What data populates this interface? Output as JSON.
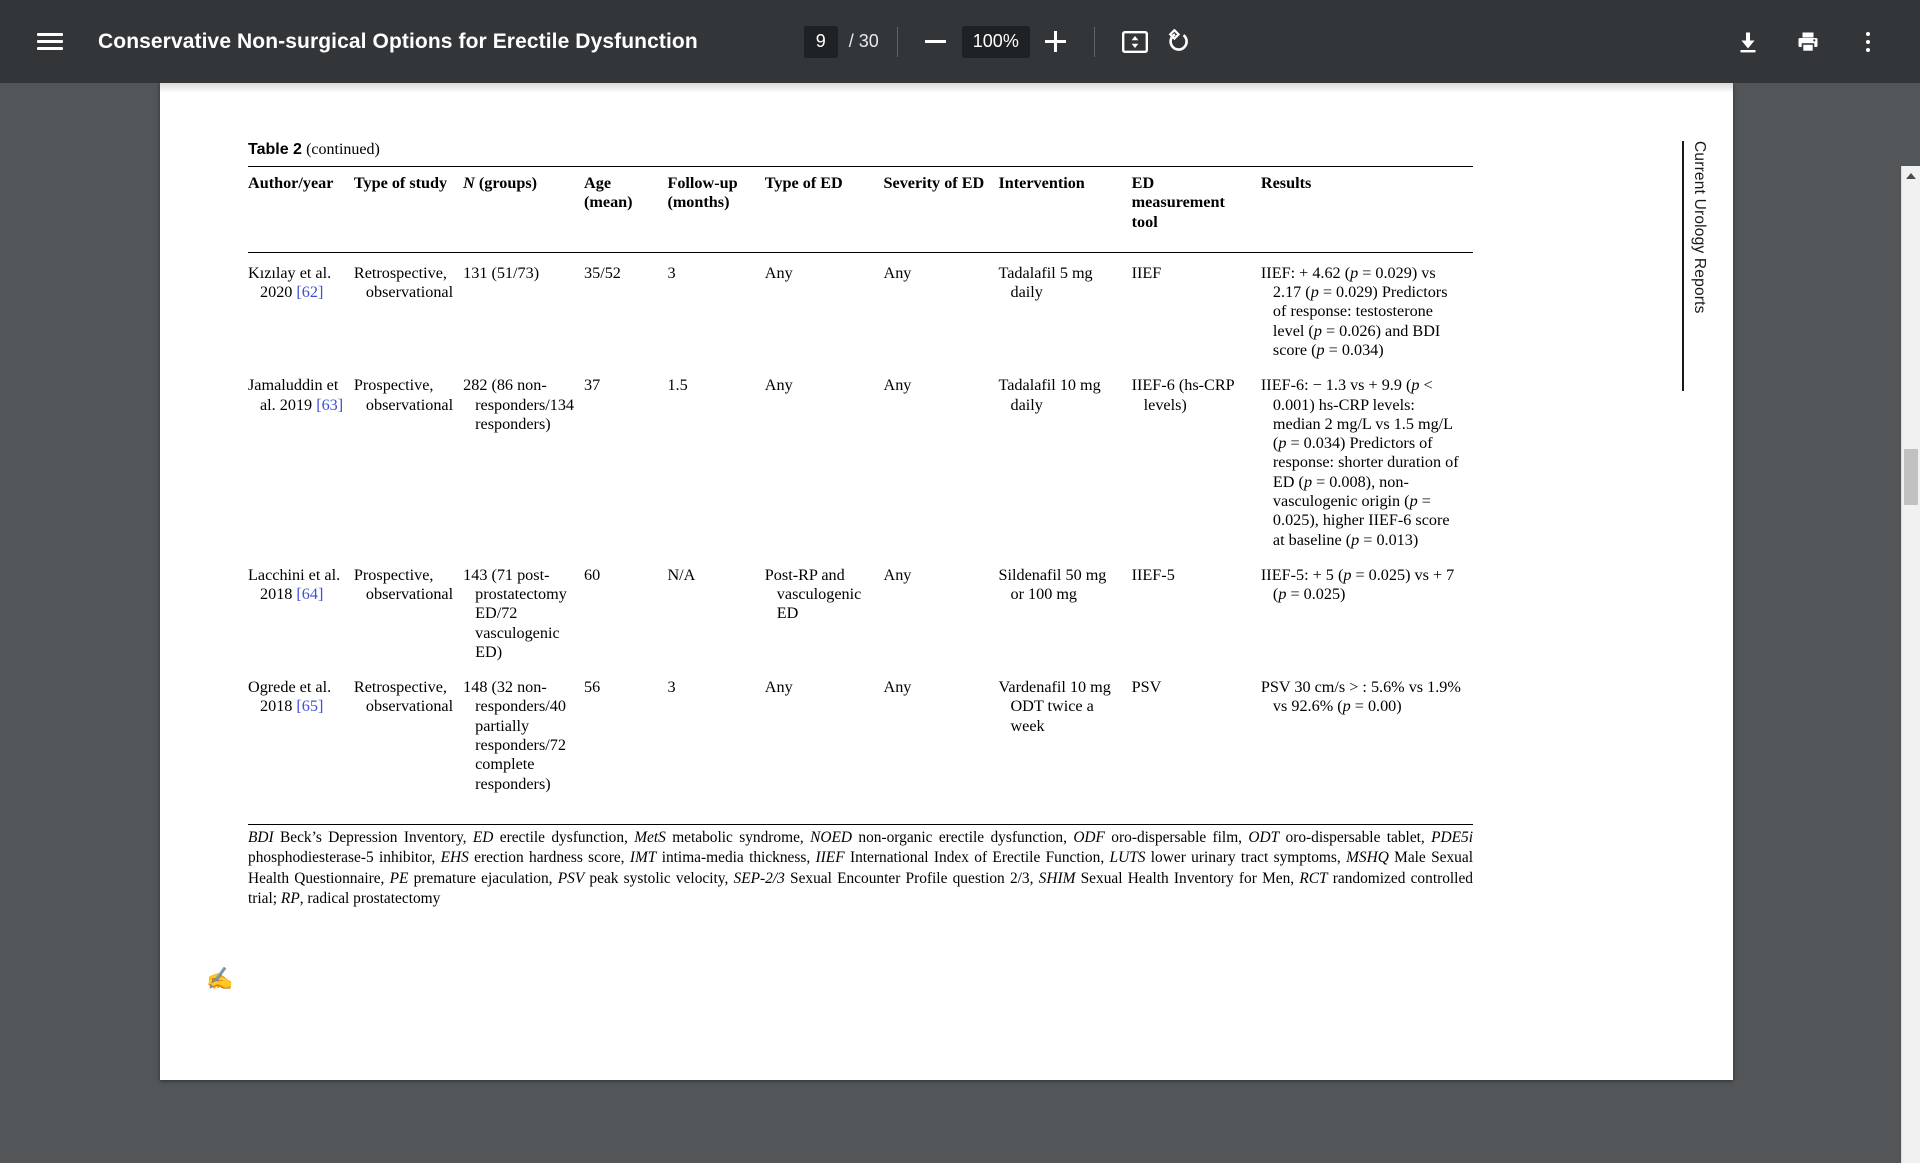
{
  "toolbar": {
    "menu_icon": "hamburger-menu-icon",
    "title": "Conservative Non-surgical Options for Erectile Dysfunction",
    "page_current": "9",
    "page_total": "/ 30",
    "zoom_out_icon": "minus-icon",
    "zoom_level": "100%",
    "zoom_in_icon": "plus-icon",
    "fit_icon": "fit-to-page-icon",
    "rotate_icon": "rotate-counterclockwise-icon",
    "download_icon": "download-icon",
    "print_icon": "print-icon",
    "more_icon": "more-vertical-icon"
  },
  "scrollbar": {
    "up_arrow_icon": "scroll-up-arrow-icon",
    "thumb": "scroll-thumb"
  },
  "page": {
    "journal_label": "Current Urology Reports",
    "hand_glyph": "✍",
    "table": {
      "caption_label": "Table 2",
      "caption_continued": "(continued)",
      "headers": [
        "Author/year",
        "Type of study",
        "N (groups)",
        "Age (mean)",
        "Follow-up (months)",
        "Type of ED",
        "Severity of ED",
        "Intervention",
        "ED measurement tool",
        "Results"
      ],
      "rows": [
        {
          "author": "Kızılay et al. 2020",
          "ref": "[62]",
          "type_of_study": "Retrospective, observational",
          "n_groups": "131 (51/73)",
          "age_mean": "35/52",
          "follow_up": "3",
          "type_of_ed": "Any",
          "severity_of_ed": "Any",
          "intervention": "Tadalafil 5 mg daily",
          "measurement_tool": "IIEF",
          "results": "IIEF: + 4.62 (p = 0.029) vs 2.17 (p = 0.029) Predictors of response: testosterone level (p = 0.026) and BDI score (p = 0.034)"
        },
        {
          "author": "Jamaluddin et al. 2019",
          "ref": "[63]",
          "type_of_study": "Prospective, observational",
          "n_groups": "282 (86 non-responders/134 responders)",
          "age_mean": "37",
          "follow_up": "1.5",
          "type_of_ed": "Any",
          "severity_of_ed": "Any",
          "intervention": "Tadalafil 10 mg daily",
          "measurement_tool": "IIEF-6 (hs-CRP levels)",
          "results": "IIEF-6: − 1.3 vs + 9.9 (p < 0.001) hs-CRP levels: median 2 mg/L vs 1.5 mg/L (p = 0.034) Predictors of response: shorter duration of ED (p = 0.008), non-vasculogenic origin (p = 0.025), higher IIEF-6 score at baseline (p = 0.013)"
        },
        {
          "author": "Lacchini et al. 2018",
          "ref": "[64]",
          "type_of_study": "Prospective, observational",
          "n_groups": "143 (71 post-prostatectomy ED/72 vasculogenic ED)",
          "age_mean": "60",
          "follow_up": "N/A",
          "type_of_ed": "Post-RP and vasculogenic ED",
          "severity_of_ed": "Any",
          "intervention": "Sildenafil 50 mg or 100 mg",
          "measurement_tool": "IIEF-5",
          "results": "IIEF-5: + 5 (p = 0.025) vs + 7 (p = 0.025)"
        },
        {
          "author": "Ogrede et al. 2018",
          "ref": "[65]",
          "type_of_study": "Retrospective, observational",
          "n_groups": "148 (32 non-responders/40 partially responders/72 complete responders)",
          "age_mean": "56",
          "follow_up": "3",
          "type_of_ed": "Any",
          "severity_of_ed": "Any",
          "intervention": "Vardenafil 10 mg ODT twice a week",
          "measurement_tool": "PSV",
          "results": "PSV 30 cm/s > : 5.6% vs 1.9% vs 92.6% (p = 0.00)"
        }
      ]
    },
    "footnote_parts": [
      {
        "abbr": "BDI",
        "text": " Beck’s Depression Inventory, "
      },
      {
        "abbr": "ED",
        "text": " erectile dysfunction, "
      },
      {
        "abbr": "MetS",
        "text": " metabolic syndrome, "
      },
      {
        "abbr": "NOED",
        "text": " non-organic erectile dysfunction, "
      },
      {
        "abbr": "ODF",
        "text": " oro-dispersable film, "
      },
      {
        "abbr": "ODT",
        "text": " oro-dispersable tablet, "
      },
      {
        "abbr": "PDE5i",
        "text": " phosphodiesterase-5 inhibitor, "
      },
      {
        "abbr": "EHS",
        "text": " erection hardness score, "
      },
      {
        "abbr": "IMT",
        "text": " intima-media thickness, "
      },
      {
        "abbr": "IIEF",
        "text": " International Index of Erectile Function, "
      },
      {
        "abbr": "LUTS",
        "text": " lower urinary tract symptoms, "
      },
      {
        "abbr": "MSHQ",
        "text": " Male Sexual Health Questionnaire, "
      },
      {
        "abbr": "PE",
        "text": " premature ejaculation, "
      },
      {
        "abbr": "PSV",
        "text": " peak systolic velocity, "
      },
      {
        "abbr": "SEP-2/3",
        "text": " Sexual Encounter Profile question 2/3, "
      },
      {
        "abbr": "SHIM",
        "text": " Sexual Health Inventory for Men, "
      },
      {
        "abbr": "RCT",
        "text": " randomized controlled trial; "
      },
      {
        "abbr": "RP",
        "text": ", radical prostatectomy"
      }
    ]
  },
  "colors": {
    "toolbar_bg": "#323639",
    "viewer_bg": "#525659",
    "page_bg": "#ffffff",
    "ref_link": "#3c4fd4"
  }
}
